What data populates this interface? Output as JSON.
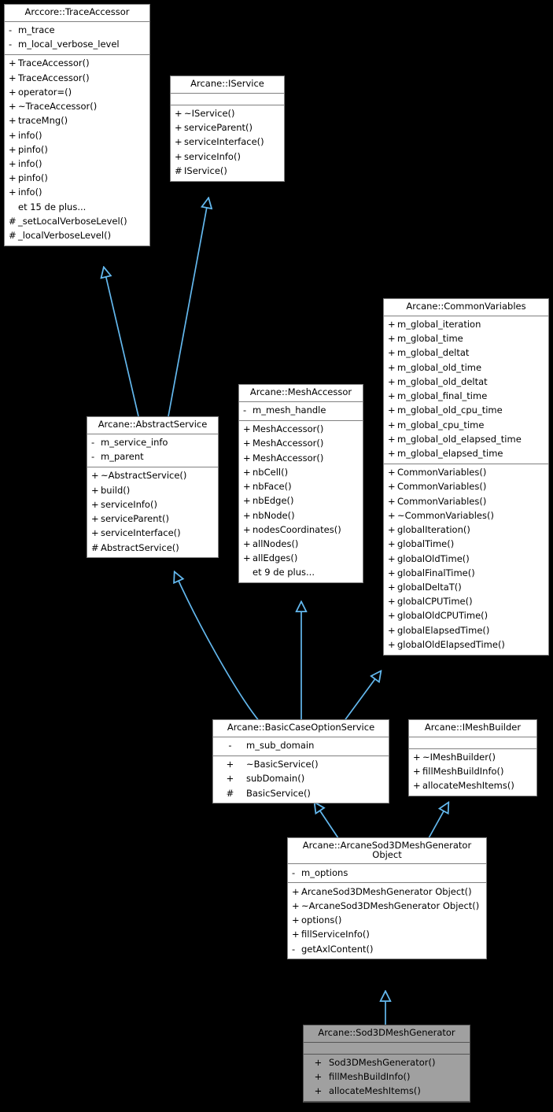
{
  "diagram": {
    "kind": "uml-class-inheritance",
    "background_color": "#000000",
    "node_fill": "#ffffff",
    "node_border": "#808080",
    "highlight_fill": "#a0a0a0",
    "edge_color": "#63b8ee",
    "more_label_trace": "et 15 de plus...",
    "more_label_mesh": "et 9 de plus..."
  },
  "nodes": {
    "trace_accessor": {
      "title": "Arccore::TraceAccessor",
      "attributes": [
        {
          "vis": "-",
          "name": "m_trace"
        },
        {
          "vis": "-",
          "name": "m_local_verbose_level"
        }
      ],
      "methods": [
        {
          "vis": "+",
          "name": "TraceAccessor()"
        },
        {
          "vis": "+",
          "name": "TraceAccessor()"
        },
        {
          "vis": "+",
          "name": "operator=()"
        },
        {
          "vis": "+",
          "name": "~TraceAccessor()"
        },
        {
          "vis": "+",
          "name": "traceMng()"
        },
        {
          "vis": "+",
          "name": "info()"
        },
        {
          "vis": "+",
          "name": "pinfo()"
        },
        {
          "vis": "+",
          "name": "info()"
        },
        {
          "vis": "+",
          "name": "pinfo()"
        },
        {
          "vis": "+",
          "name": "info()"
        },
        {
          "vis": "",
          "name": "et 15 de plus..."
        },
        {
          "vis": "#",
          "name": "_setLocalVerboseLevel()"
        },
        {
          "vis": "#",
          "name": "_localVerboseLevel()"
        }
      ]
    },
    "iservice": {
      "title": "Arcane::IService",
      "attributes": [],
      "methods": [
        {
          "vis": "+",
          "name": "~IService()"
        },
        {
          "vis": "+",
          "name": "serviceParent()"
        },
        {
          "vis": "+",
          "name": "serviceInterface()"
        },
        {
          "vis": "+",
          "name": "serviceInfo()"
        },
        {
          "vis": "#",
          "name": "IService()"
        }
      ]
    },
    "abstract_service": {
      "title": "Arcane::AbstractService",
      "attributes": [
        {
          "vis": "-",
          "name": "m_service_info"
        },
        {
          "vis": "-",
          "name": "m_parent"
        }
      ],
      "methods": [
        {
          "vis": "+",
          "name": "~AbstractService()"
        },
        {
          "vis": "+",
          "name": "build()"
        },
        {
          "vis": "+",
          "name": "serviceInfo()"
        },
        {
          "vis": "+",
          "name": "serviceParent()"
        },
        {
          "vis": "+",
          "name": "serviceInterface()"
        },
        {
          "vis": "#",
          "name": "AbstractService()"
        }
      ]
    },
    "mesh_accessor": {
      "title": "Arcane::MeshAccessor",
      "attributes": [
        {
          "vis": "-",
          "name": "m_mesh_handle"
        }
      ],
      "methods": [
        {
          "vis": "+",
          "name": "MeshAccessor()"
        },
        {
          "vis": "+",
          "name": "MeshAccessor()"
        },
        {
          "vis": "+",
          "name": "MeshAccessor()"
        },
        {
          "vis": "+",
          "name": "nbCell()"
        },
        {
          "vis": "+",
          "name": "nbFace()"
        },
        {
          "vis": "+",
          "name": "nbEdge()"
        },
        {
          "vis": "+",
          "name": "nbNode()"
        },
        {
          "vis": "+",
          "name": "nodesCoordinates()"
        },
        {
          "vis": "+",
          "name": "allNodes()"
        },
        {
          "vis": "+",
          "name": "allEdges()"
        },
        {
          "vis": "",
          "name": "et 9 de plus..."
        }
      ]
    },
    "common_variables": {
      "title": "Arcane::CommonVariables",
      "attributes": [
        {
          "vis": "+",
          "name": "m_global_iteration"
        },
        {
          "vis": "+",
          "name": "m_global_time"
        },
        {
          "vis": "+",
          "name": "m_global_deltat"
        },
        {
          "vis": "+",
          "name": "m_global_old_time"
        },
        {
          "vis": "+",
          "name": "m_global_old_deltat"
        },
        {
          "vis": "+",
          "name": "m_global_final_time"
        },
        {
          "vis": "+",
          "name": "m_global_old_cpu_time"
        },
        {
          "vis": "+",
          "name": "m_global_cpu_time"
        },
        {
          "vis": "+",
          "name": "m_global_old_elapsed_time"
        },
        {
          "vis": "+",
          "name": "m_global_elapsed_time"
        }
      ],
      "methods": [
        {
          "vis": "+",
          "name": "CommonVariables()"
        },
        {
          "vis": "+",
          "name": "CommonVariables()"
        },
        {
          "vis": "+",
          "name": "CommonVariables()"
        },
        {
          "vis": "+",
          "name": "~CommonVariables()"
        },
        {
          "vis": "+",
          "name": "globalIteration()"
        },
        {
          "vis": "+",
          "name": "globalTime()"
        },
        {
          "vis": "+",
          "name": "globalOldTime()"
        },
        {
          "vis": "+",
          "name": "globalFinalTime()"
        },
        {
          "vis": "+",
          "name": "globalDeltaT()"
        },
        {
          "vis": "+",
          "name": "globalCPUTime()"
        },
        {
          "vis": "+",
          "name": "globalOldCPUTime()"
        },
        {
          "vis": "+",
          "name": "globalElapsedTime()"
        },
        {
          "vis": "+",
          "name": "globalOldElapsedTime()"
        }
      ]
    },
    "basic_case_option_service": {
      "title": "Arcane::BasicCaseOptionService",
      "attributes": [
        {
          "vis": "-",
          "name": "m_sub_domain"
        }
      ],
      "methods": [
        {
          "vis": "+",
          "name": "~BasicService()"
        },
        {
          "vis": "+",
          "name": "subDomain()"
        },
        {
          "vis": "#",
          "name": "BasicService()"
        }
      ]
    },
    "imesh_builder": {
      "title": "Arcane::IMeshBuilder",
      "attributes": [],
      "methods": [
        {
          "vis": "+",
          "name": "~IMeshBuilder()"
        },
        {
          "vis": "+",
          "name": "fillMeshBuildInfo()"
        },
        {
          "vis": "+",
          "name": "allocateMeshItems()"
        }
      ]
    },
    "sod3d_object": {
      "title": "Arcane::ArcaneSod3DMeshGenerator Object",
      "attributes": [
        {
          "vis": "-",
          "name": "m_options"
        }
      ],
      "methods": [
        {
          "vis": "+",
          "name": "ArcaneSod3DMeshGenerator Object()"
        },
        {
          "vis": "+",
          "name": "~ArcaneSod3DMeshGenerator Object()"
        },
        {
          "vis": "+",
          "name": "options()"
        },
        {
          "vis": "+",
          "name": "fillServiceInfo()"
        },
        {
          "vis": "-",
          "name": "getAxlContent()"
        }
      ]
    },
    "sod3d_generator": {
      "title": "Arcane::Sod3DMeshGenerator",
      "attributes": [],
      "methods": [
        {
          "vis": "+",
          "name": "Sod3DMeshGenerator()"
        },
        {
          "vis": "+",
          "name": "fillMeshBuildInfo()"
        },
        {
          "vis": "+",
          "name": "allocateMeshItems()"
        }
      ]
    }
  },
  "edges": [
    {
      "from": "abstract_service",
      "to": "trace_accessor",
      "type": "inheritance"
    },
    {
      "from": "abstract_service",
      "to": "iservice",
      "type": "inheritance"
    },
    {
      "from": "basic_case_option_service",
      "to": "abstract_service",
      "type": "inheritance"
    },
    {
      "from": "basic_case_option_service",
      "to": "mesh_accessor",
      "type": "inheritance"
    },
    {
      "from": "basic_case_option_service",
      "to": "common_variables",
      "type": "inheritance"
    },
    {
      "from": "sod3d_object",
      "to": "basic_case_option_service",
      "type": "inheritance"
    },
    {
      "from": "sod3d_object",
      "to": "imesh_builder",
      "type": "inheritance"
    },
    {
      "from": "sod3d_generator",
      "to": "sod3d_object",
      "type": "inheritance"
    }
  ]
}
